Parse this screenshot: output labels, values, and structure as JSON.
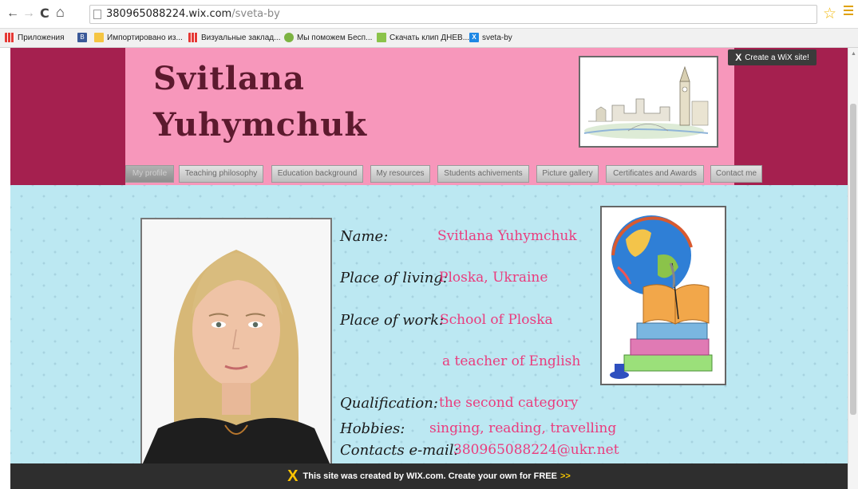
{
  "browser": {
    "back_icon": "←",
    "forward_icon": "→",
    "reload_icon": "C",
    "home_icon": "⌂",
    "url_host": "380965088224.wix.com",
    "url_path": "/sveta-by",
    "star_icon": "☆"
  },
  "bookmarks": [
    {
      "label": "Приложения",
      "icon_color": "#e53935"
    },
    {
      "label": "",
      "icon_color": "#3b5998"
    },
    {
      "label": "Импортировано из...",
      "icon_color": "#f5c542"
    },
    {
      "label": "Визуальные заклад...",
      "icon_color": "#e53935"
    },
    {
      "label": "Мы поможем Бесп...",
      "icon_color": "#7cb342"
    },
    {
      "label": "Скачать клип ДНЕВ...",
      "icon_color": "#8bc34a"
    },
    {
      "label": "sveta-by",
      "icon_color": "#1e88e5"
    }
  ],
  "site": {
    "title_line1": "Svitlana",
    "title_line2": "Yuhymchuk",
    "create_wix": "Create a WiX site!",
    "nav": [
      "My profile",
      "Teaching philosophy",
      "Education background",
      "My resources",
      "Students achivements",
      "Picture gallery",
      "Certificates and Awards",
      "Contact me"
    ],
    "profile": {
      "name_label": "Name:",
      "name_value": "Svitlana Yuhymchuk",
      "living_label": "Place of living:",
      "living_value": "Ploska, Ukraine",
      "work_label": "Place of work:",
      "work_value": "School of Ploska",
      "work_value2": "a teacher of English",
      "qual_label": "Qualification:",
      "qual_value": "the second category",
      "hobbies_label": "Hobbies:",
      "hobbies_value": "singing, reading, travelling",
      "email_label": "Contacts e-mail:",
      "email_value": "380965088224@ukr.net"
    },
    "footer_text": "This site was created by WIX.com. Create your own for FREE",
    "footer_arrows": ">>"
  },
  "colors": {
    "header_band": "#a5204f",
    "header_center": "#f797bb",
    "content_bg": "#bce8f2",
    "value_text": "#ea3c7d"
  }
}
